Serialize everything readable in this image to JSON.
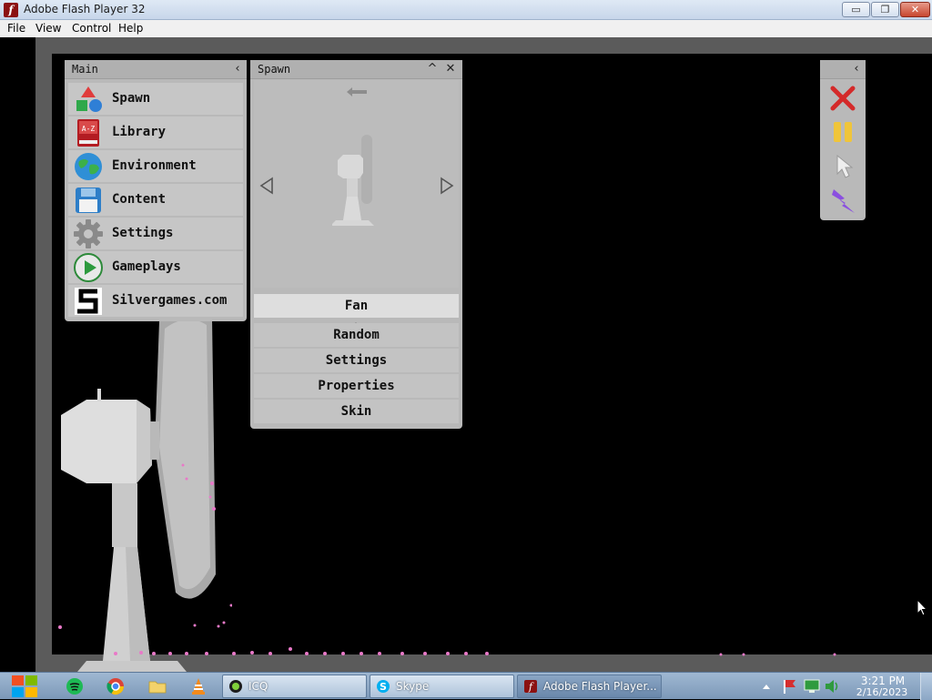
{
  "window": {
    "title": "Adobe Flash Player 32"
  },
  "window_controls": {
    "minimize": "▭",
    "restore": "❐",
    "close": "✕"
  },
  "menubar": {
    "items": [
      "File",
      "View",
      "Control",
      "Help"
    ]
  },
  "main_panel": {
    "title": "Main",
    "collapse_glyph": "‹",
    "items": [
      {
        "label": "Spawn",
        "icon": "shapes-icon"
      },
      {
        "label": "Library",
        "icon": "book-icon"
      },
      {
        "label": "Environment",
        "icon": "globe-icon"
      },
      {
        "label": "Content",
        "icon": "floppy-disk-icon"
      },
      {
        "label": "Settings",
        "icon": "gear-icon"
      },
      {
        "label": "Gameplays",
        "icon": "play-icon"
      },
      {
        "label": "Silvergames.com",
        "icon": "silvergames-logo-icon"
      }
    ]
  },
  "spawn_panel": {
    "title": "Spawn",
    "collapse_glyph": "^",
    "close_glyph": "✕",
    "selected_item": "Fan",
    "buttons": [
      "Random",
      "Settings",
      "Properties",
      "Skin"
    ]
  },
  "taskbar": {
    "tasks": [
      {
        "label": "ICQ",
        "icon": "icq-icon"
      },
      {
        "label": "Skype",
        "icon": "skype-icon"
      },
      {
        "label": "Adobe Flash Player...",
        "icon": "flash-icon"
      }
    ],
    "clock": {
      "time": "3:21 PM",
      "date": "2/16/2023"
    }
  },
  "colors": {
    "panel_bg": "#b9b9b9",
    "frame": "#5b5b5b",
    "stage_bg": "#000000",
    "particles": "#e879c8"
  }
}
